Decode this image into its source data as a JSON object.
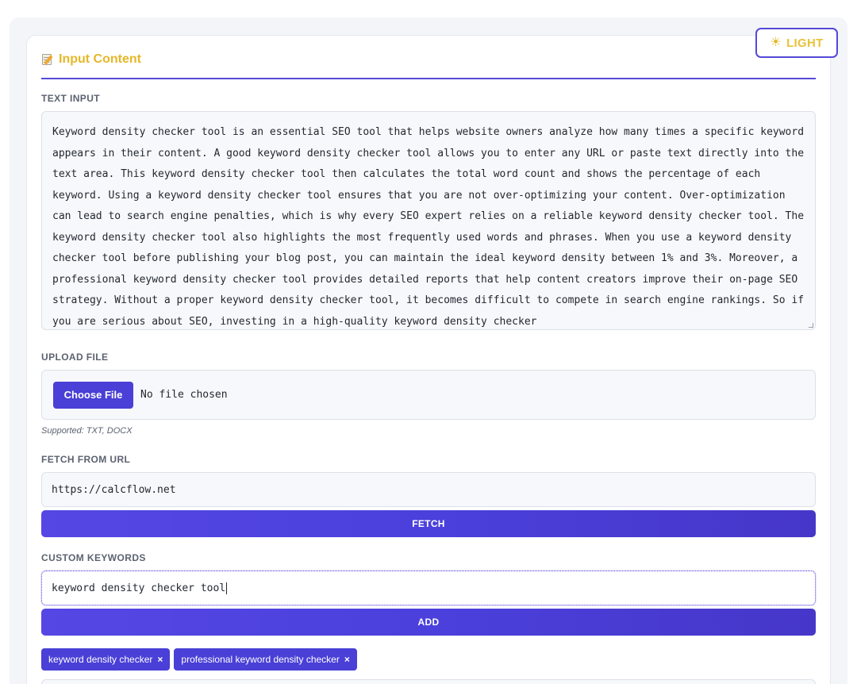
{
  "theme_toggle": {
    "icon": "sun-icon",
    "label": "LIGHT"
  },
  "section": {
    "icon": "memo-icon",
    "title": "Input Content"
  },
  "text_input": {
    "label": "TEXT INPUT",
    "value": "Keyword density checker tool is an essential SEO tool that helps website owners analyze how many times a specific keyword appears in their content. A good keyword density checker tool allows you to enter any URL or paste text directly into the text area. This keyword density checker tool then calculates the total word count and shows the percentage of each keyword. Using a keyword density checker tool ensures that you are not over-optimizing your content. Over-optimization can lead to search engine penalties, which is why every SEO expert relies on a reliable keyword density checker tool. The keyword density checker tool also highlights the most frequently used words and phrases. When you use a keyword density checker tool before publishing your blog post, you can maintain the ideal keyword density between 1% and 3%. Moreover, a professional keyword density checker tool provides detailed reports that help content creators improve their on-page SEO strategy. Without a proper keyword density checker tool, it becomes difficult to compete in search engine rankings. So if you are serious about SEO, investing in a high-quality keyword density checker"
  },
  "upload": {
    "label": "UPLOAD FILE",
    "button_label": "Choose File",
    "status": "No file chosen",
    "hint": "Supported: TXT, DOCX"
  },
  "fetch": {
    "label": "FETCH FROM URL",
    "value": "https://calcflow.net",
    "button_label": "FETCH"
  },
  "keywords": {
    "label": "CUSTOM KEYWORDS",
    "value": "keyword density checker tool",
    "button_label": "ADD",
    "chips": [
      {
        "label": "keyword density checker",
        "remove": "×"
      },
      {
        "label": "professional keyword density checker",
        "remove": "×"
      }
    ]
  },
  "colors": {
    "accent": "#4a3fd6",
    "title": "#e6b728"
  }
}
